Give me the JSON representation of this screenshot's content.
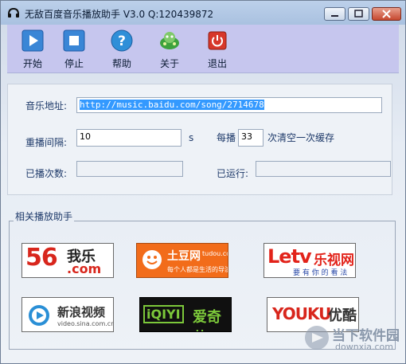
{
  "window": {
    "title": "无敌百度音乐播放助手 V3.0  Q:120439872"
  },
  "toolbar": {
    "items": [
      {
        "label": "开始",
        "icon": "play-icon"
      },
      {
        "label": "停止",
        "icon": "stop-icon"
      },
      {
        "label": "帮助",
        "icon": "help-icon"
      },
      {
        "label": "关于",
        "icon": "about-icon"
      },
      {
        "label": "退出",
        "icon": "power-icon"
      }
    ]
  },
  "form": {
    "url_label": "音乐地址:",
    "url_value": "http://music.baidu.com/song/2714678",
    "interval_label": "重播间隔:",
    "interval_value": "10",
    "interval_unit": "s",
    "every_label": "每播",
    "every_value": "33",
    "cache_label": "次清空一次缓存",
    "played_label": "已播次数:",
    "played_value": "",
    "running_label": "已运行:",
    "running_value": ""
  },
  "related": {
    "title": "相关播放助手",
    "logos": [
      {
        "name": "56",
        "text_a": "56",
        "text_b": "我乐",
        "text_c": ".com"
      },
      {
        "name": "tudou",
        "text_a": "土豆网",
        "text_b": "tudou.com",
        "text_c": "每个人都是生活的导演"
      },
      {
        "name": "letv",
        "text_a": "Letv",
        "text_b": "乐视网",
        "text_c": "要 有 你 的 看 法"
      },
      {
        "name": "sina",
        "text_a": "新浪视频",
        "text_b": "video.sina.com.cn"
      },
      {
        "name": "iqiyi",
        "text_a": "iQIYI",
        "text_b": "爱奇艺"
      },
      {
        "name": "youku",
        "text_a": "YOUKU",
        "text_b": "优酷"
      }
    ]
  },
  "watermark": {
    "text_a": "当下软件园",
    "text_b": "downxia.com"
  },
  "colors": {
    "toolbar_bg": "#c6c6ee",
    "url_selection": "#3399ff",
    "tudou_orange": "#f26c1a",
    "youku_red": "#d8261c"
  }
}
